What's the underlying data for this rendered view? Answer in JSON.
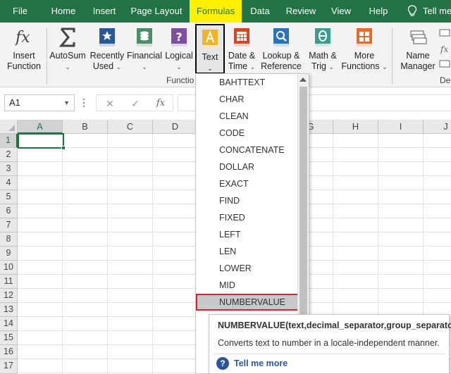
{
  "tabs": [
    "File",
    "Home",
    "Insert",
    "Page Layout",
    "Formulas",
    "Data",
    "Review",
    "View",
    "Help"
  ],
  "active_tab": "Formulas",
  "tell_me_text": "Tell me",
  "colors": {
    "tab_bar": "#217346",
    "active_tab_highlight": "#fff200",
    "excel_green": "#217346",
    "selection_outline": "#d9232d"
  },
  "ribbon": {
    "insert_function": {
      "line1": "Insert",
      "line2": "Function",
      "icon": "fx-icon"
    },
    "autosum": {
      "line1": "AutoSum",
      "line2": "⌄",
      "icon": "sigma-icon"
    },
    "recently_used": {
      "line1": "Recently",
      "line2": "Used",
      "icon": "star-book-icon"
    },
    "financial": {
      "line1": "Financial",
      "line2": "⌄",
      "icon": "money-book-icon"
    },
    "logical": {
      "line1": "Logical",
      "line2": "⌄",
      "icon": "question-book-icon"
    },
    "text": {
      "line1": "Text",
      "line2": "⌄",
      "icon": "text-book-icon"
    },
    "date_time": {
      "line1": "Date &",
      "line2": "Time",
      "icon": "calendar-book-icon"
    },
    "lookup": {
      "line1": "Lookup &",
      "line2": "Reference",
      "icon": "magnifier-book-icon"
    },
    "math": {
      "line1": "Math &",
      "line2": "Trig",
      "icon": "theta-book-icon"
    },
    "more": {
      "line1": "More",
      "line2": "Functions",
      "icon": "grid-book-icon"
    },
    "name_manager": {
      "line1": "Name",
      "line2": "Manager",
      "icon": "name-tags-icon"
    },
    "function_group_label": "Functio",
    "defined_group_label": "De"
  },
  "formula_bar": {
    "name_box": "A1",
    "fx_label": "fx"
  },
  "grid": {
    "columns": [
      "A",
      "B",
      "C",
      "D",
      "",
      "G",
      "H",
      "I",
      "J"
    ],
    "rows": [
      "1",
      "2",
      "3",
      "4",
      "5",
      "6",
      "7",
      "8",
      "9",
      "10",
      "11",
      "12",
      "13",
      "14",
      "15",
      "16",
      "17"
    ],
    "active_cell": "A1"
  },
  "dropdown": {
    "items": [
      "BAHTTEXT",
      "CHAR",
      "CLEAN",
      "CODE",
      "CONCATENATE",
      "DOLLAR",
      "EXACT",
      "FIND",
      "FIXED",
      "LEFT",
      "LEN",
      "LOWER",
      "MID",
      "NUMBERVALUE"
    ],
    "highlighted": "NUMBERVALUE"
  },
  "tooltip": {
    "signature": "NUMBERVALUE(text,decimal_separator,group_separator)",
    "description": "Converts text to number in a locale-independent manner.",
    "help_link": "Tell me more"
  }
}
